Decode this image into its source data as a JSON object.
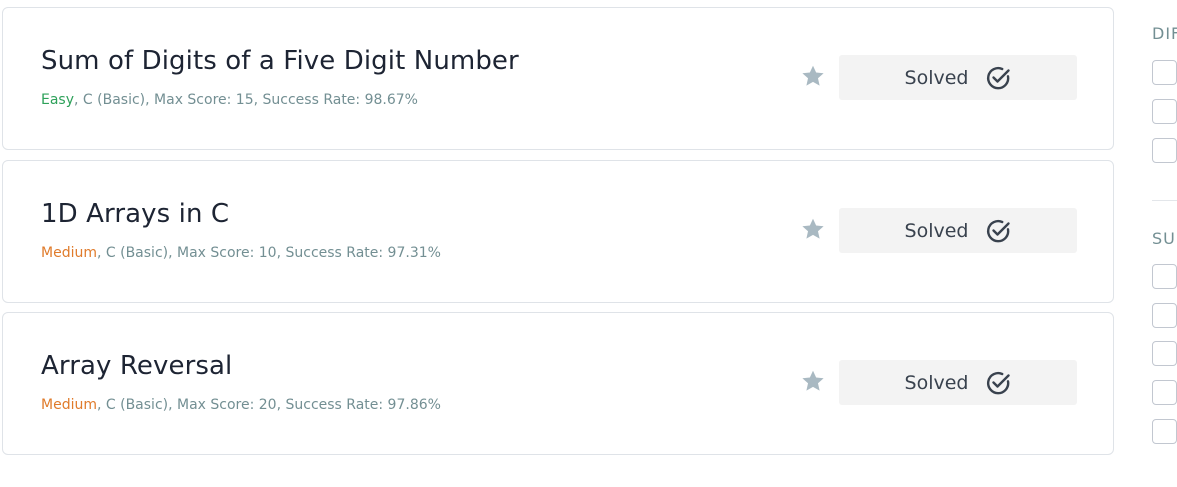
{
  "challenges": [
    {
      "title": "Sum of Digits of a Five Digit Number",
      "difficulty": "Easy",
      "details": ", C (Basic), Max Score: 15, Success Rate: 98.67%",
      "status_label": "Solved"
    },
    {
      "title": "1D Arrays in C",
      "difficulty": "Medium",
      "details": ", C (Basic), Max Score: 10, Success Rate: 97.31%",
      "status_label": "Solved"
    },
    {
      "title": "Array Reversal",
      "difficulty": "Medium",
      "details": ", C (Basic), Max Score: 20, Success Rate: 97.86%",
      "status_label": "Solved"
    }
  ],
  "sidebar": {
    "difficulty_heading": "DIF",
    "subdomain_heading": "SUI",
    "difficulty_checkbox_count": 3,
    "subdomain_checkbox_count": 5
  },
  "icons": {
    "star": "star-icon",
    "check": "check-circle-icon"
  },
  "colors": {
    "easy": "#2ea15a",
    "medium": "#e07b2b",
    "meta_text": "#738f93",
    "star": "#a9b9c2",
    "button_bg": "#f3f3f3",
    "title_text": "#1d2433"
  }
}
